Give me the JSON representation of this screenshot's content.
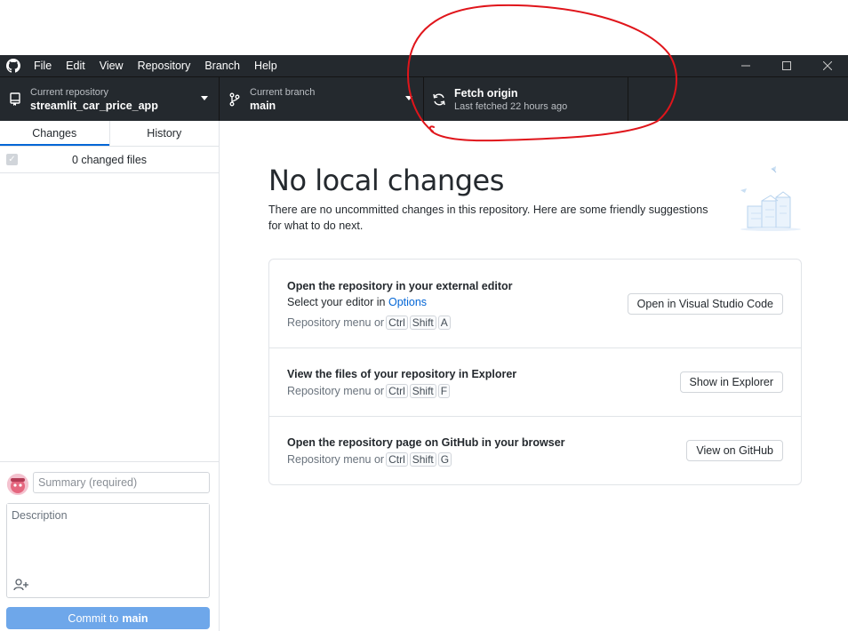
{
  "menu": [
    "File",
    "Edit",
    "View",
    "Repository",
    "Branch",
    "Help"
  ],
  "window_controls": {
    "minimize": "—",
    "maximize": "☐",
    "close": "✕"
  },
  "toolbar": {
    "repo_label": "Current repository",
    "repo_value": "streamlit_car_price_app",
    "branch_label": "Current branch",
    "branch_value": "main",
    "fetch_label": "Fetch origin",
    "fetch_sub": "Last fetched 22 hours ago"
  },
  "sidebar": {
    "tabs": [
      "Changes",
      "History"
    ],
    "active_tab": "Changes",
    "changed_files": "0 changed files",
    "summary_placeholder": "Summary (required)",
    "description_placeholder": "Description",
    "commit_prefix": "Commit to",
    "commit_branch": "main"
  },
  "main": {
    "heading": "No local changes",
    "subtext": "There are no uncommitted changes in this repository. Here are some friendly suggestions for what to do next.",
    "suggestions": [
      {
        "title": "Open the repository in your external editor",
        "subtitle": "Select your editor in",
        "subtitle_link": "Options",
        "hint": "Repository menu or",
        "keys": [
          "Ctrl",
          "Shift",
          "A"
        ],
        "button": "Open in Visual Studio Code"
      },
      {
        "title": "View the files of your repository in Explorer",
        "hint": "Repository menu or",
        "keys": [
          "Ctrl",
          "Shift",
          "F"
        ],
        "button": "Show in Explorer"
      },
      {
        "title": "Open the repository page on GitHub in your browser",
        "hint": "Repository menu or",
        "keys": [
          "Ctrl",
          "Shift",
          "G"
        ],
        "button": "View on GitHub"
      }
    ]
  },
  "colors": {
    "chrome": "#24292e",
    "accent": "#0366d6",
    "commit_button": "#6ea7ea",
    "annotation": "#e0151b"
  }
}
